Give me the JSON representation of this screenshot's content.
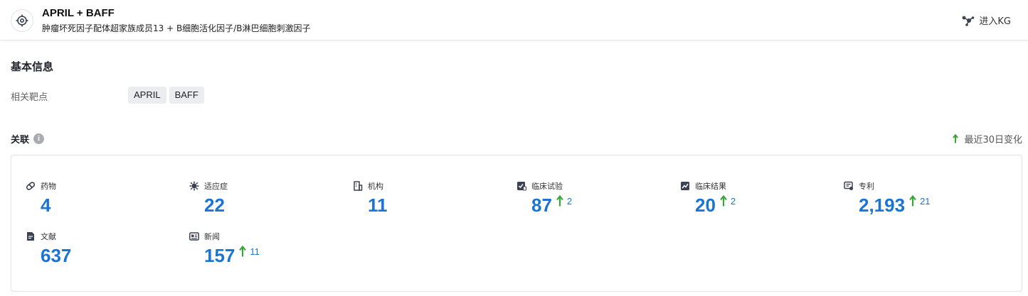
{
  "header": {
    "title": "APRIL + BAFF",
    "subtitle": "肿瘤坏死因子配体超家族成员13 + B细胞活化因子/B淋巴细胞刺激因子",
    "kg_link": "进入KG"
  },
  "basic_info": {
    "title": "基本信息",
    "targets_label": "相关靶点",
    "targets": [
      "APRIL",
      "BAFF"
    ]
  },
  "relations": {
    "title": "关联",
    "recent_change_label": "最近30日变化",
    "up_color": "#3aa63a",
    "value_color": "#1b74d4",
    "stats": [
      {
        "label": "药物",
        "icon": "pill-icon",
        "value": "4",
        "delta": ""
      },
      {
        "label": "适应症",
        "icon": "virus-icon",
        "value": "22",
        "delta": ""
      },
      {
        "label": "机构",
        "icon": "building-icon",
        "value": "11",
        "delta": ""
      },
      {
        "label": "临床试验",
        "icon": "clinical-trial-icon",
        "value": "87",
        "delta": "2"
      },
      {
        "label": "临床结果",
        "icon": "clinical-result-icon",
        "value": "20",
        "delta": "2"
      },
      {
        "label": "专利",
        "icon": "patent-icon",
        "value": "2,193",
        "delta": "21"
      },
      {
        "label": "文献",
        "icon": "document-icon",
        "value": "637",
        "delta": ""
      },
      {
        "label": "新闻",
        "icon": "news-icon",
        "value": "157",
        "delta": "11"
      }
    ]
  }
}
